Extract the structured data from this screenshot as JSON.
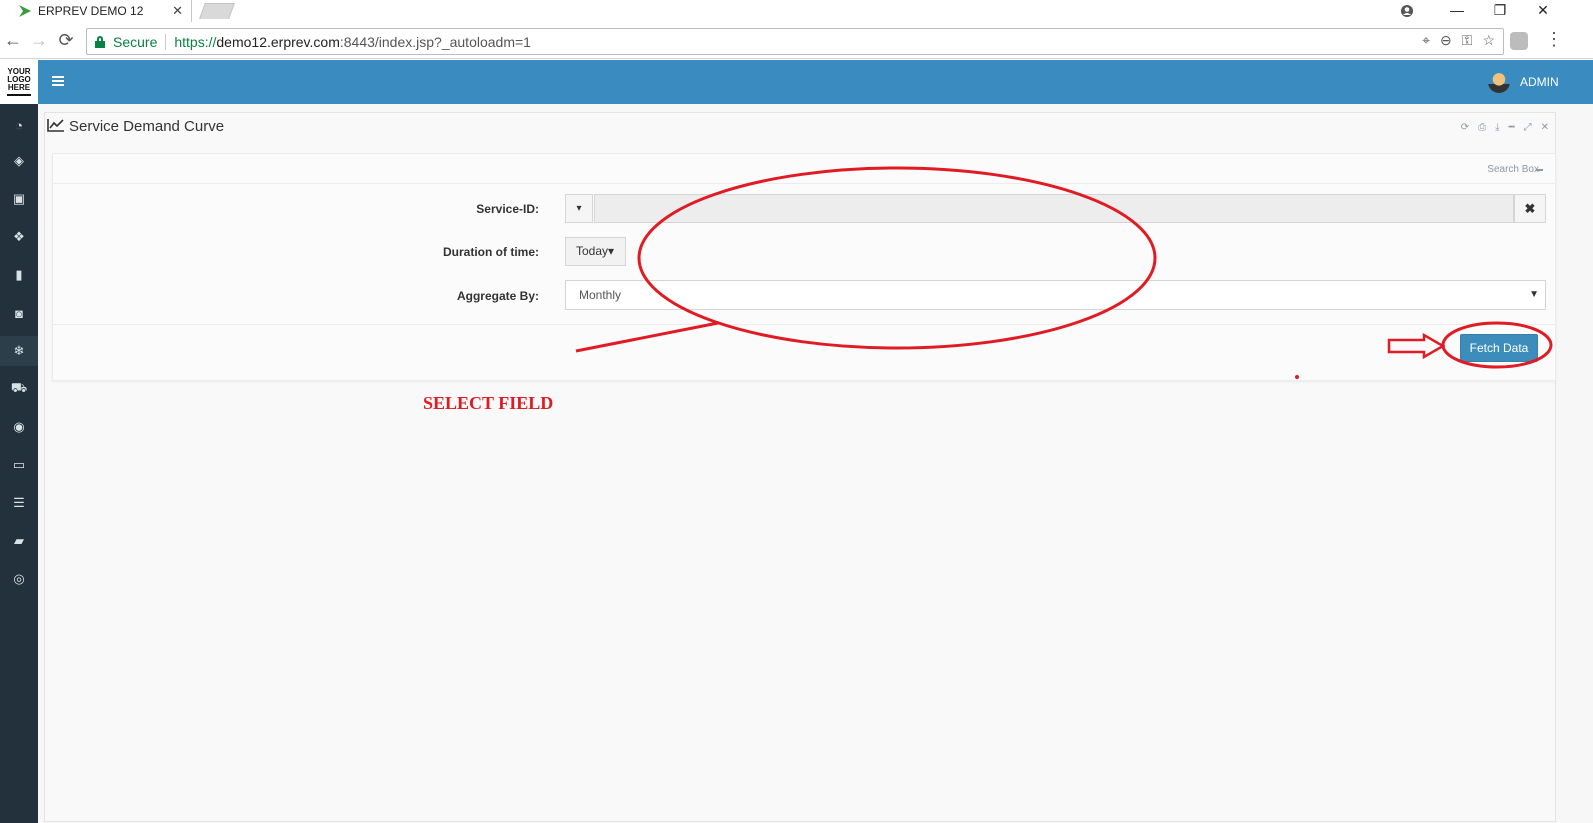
{
  "browser": {
    "tab_title": "ERPREV DEMO 12",
    "tab_close": "✕",
    "secure_label": "Secure",
    "url_scheme": "https://",
    "url_host": "demo12.erprev.com",
    "url_rest": ":8443/index.jsp?_autoloadm=1",
    "window_controls": {
      "minimize": "—",
      "restore": "❐",
      "close": "✕"
    },
    "nav": {
      "back": "←",
      "forward": "→",
      "reload": "⟳"
    },
    "omnibox_icons": [
      "location-icon",
      "zoom-out-icon",
      "key-icon",
      "star-icon"
    ],
    "menu": "⋮"
  },
  "app": {
    "logo_lines": [
      "YOUR",
      "LOGO",
      "HERE"
    ],
    "sidebar_icons": [
      "dashboard-icon",
      "tag-icon",
      "money-icon",
      "cubes-icon",
      "building-icon",
      "bucket-icon",
      "snowflake-icon",
      "cart-icon",
      "database-disk-icon",
      "desktop-icon",
      "database-icon",
      "book-icon",
      "life-ring-icon"
    ],
    "active_sidebar_index": 6,
    "user_label": "ADMIN",
    "accent_color": "#3a8cc0",
    "sidebar_color": "#22313b"
  },
  "panel": {
    "title": "Service Demand Curve",
    "tools": [
      "refresh-icon",
      "print-icon",
      "download-icon",
      "minimize-icon",
      "expand-icon",
      "close-icon"
    ],
    "search_box_label": "Search Box"
  },
  "form": {
    "service_id_label": "Service-ID:",
    "service_id_value": "",
    "duration_label": "Duration of time:",
    "duration_value": "Today",
    "aggregate_label": "Aggregate By:",
    "aggregate_value": "Monthly",
    "fetch_button": "Fetch Data",
    "clear_symbol": "✖",
    "caret_symbol": "▾",
    "select_caret": "▼"
  },
  "annotation": {
    "text": "SELECT FIELD",
    "color": "#e01b24"
  }
}
